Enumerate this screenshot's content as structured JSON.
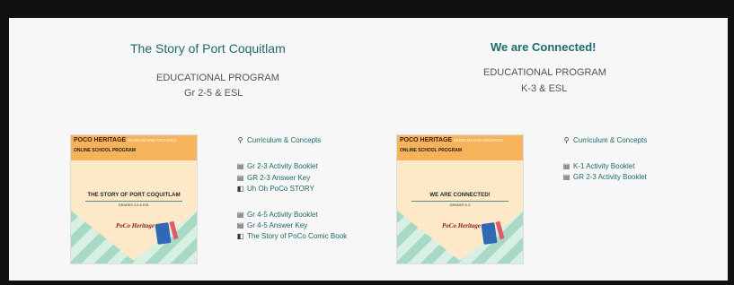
{
  "programs": [
    {
      "title": "The Story of Port Coquitlam",
      "label": "EDUCATIONAL PROGRAM",
      "grades": "Gr 2-5 & ESL",
      "thumb": {
        "brand": "POCO HERITAGE",
        "brand_sub": "MUSEUM AND ARCHIVES",
        "program": "ONLINE SCHOOL PROGRAM",
        "book_title": "THE STORY OF PORT COQUITLAM",
        "book_grades": "GRADES 2-5 & ESL",
        "logo": "PoCo Heritage"
      },
      "links": [
        {
          "icon": "location-pin-icon",
          "glyph": "⚲",
          "text": "Curriculum & Concepts"
        },
        {
          "icon": "document-icon",
          "glyph": "▤",
          "text": "Gr 2-3 Activity Booklet"
        },
        {
          "icon": "document-icon",
          "glyph": "▤",
          "text": "GR 2-3 Answer Key"
        },
        {
          "icon": "book-icon",
          "glyph": "◧",
          "text": "Uh Oh PoCo STORY"
        },
        {
          "icon": "document-icon",
          "glyph": "▤",
          "text": "Gr 4-5 Activity Booklet"
        },
        {
          "icon": "document-icon",
          "glyph": "▤",
          "text": "Gr 4-5 Answer Key"
        },
        {
          "icon": "book-icon",
          "glyph": "◧",
          "text": "The Story of PoCo Comic Book"
        }
      ]
    },
    {
      "title": "We are Connected!",
      "label": "EDUCATIONAL PROGRAM",
      "grades": "K-3 & ESL",
      "thumb": {
        "brand": "POCO HERITAGE",
        "brand_sub": "MUSEUM AND ARCHIVES",
        "program": "ONLINE SCHOOL PROGRAM",
        "book_title": "WE ARE CONNECTED!",
        "book_grades": "GRADES K-3",
        "logo": "PoCo Heritage"
      },
      "links": [
        {
          "icon": "location-pin-icon",
          "glyph": "⚲",
          "text": "Curriculum & Concepts"
        },
        {
          "icon": "document-icon",
          "glyph": "▤",
          "text": "K-1 Activity Booklet"
        },
        {
          "icon": "document-icon",
          "glyph": "▤",
          "text": "GR 2-3 Activity Booklet"
        }
      ]
    }
  ]
}
